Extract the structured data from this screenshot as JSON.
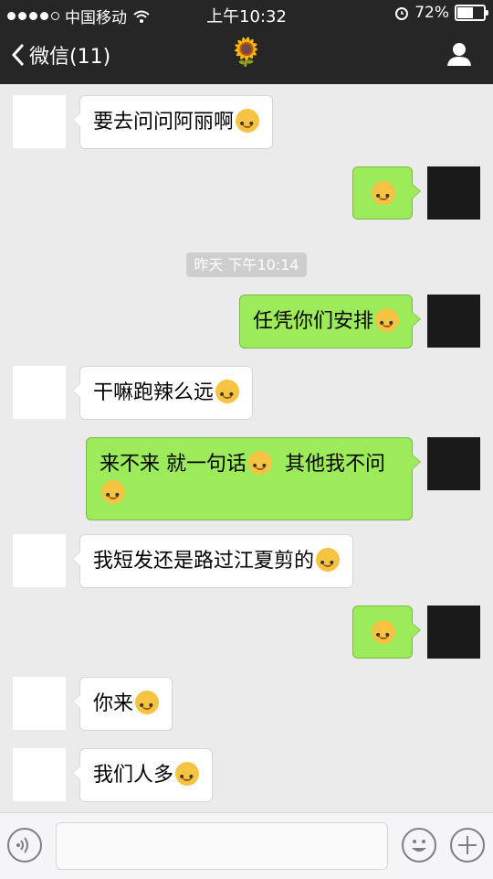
{
  "status_bar": {
    "carrier": "中国移动",
    "time": "上午10:32",
    "battery": "72%",
    "battery_level": 0.72
  },
  "nav": {
    "back_label": "微信(11)",
    "title": "🌻"
  },
  "timestamp": "昨天 下午10:14",
  "messages": [
    {
      "side": "left",
      "text": "要去问问阿丽啊",
      "emoji": true
    },
    {
      "side": "right",
      "text": "",
      "emoji": true
    },
    {
      "side": "right",
      "text": "任凭你们安排",
      "emoji": true
    },
    {
      "side": "left",
      "text": "干嘛跑辣么远",
      "emoji": true
    },
    {
      "side": "right",
      "text": "来不来 就一句话",
      "text_line2": "其他我不问",
      "emoji": true
    },
    {
      "side": "left",
      "text": "我短发还是路过江夏剪的",
      "emoji": true
    },
    {
      "side": "right",
      "text": "",
      "emoji": true
    },
    {
      "side": "left",
      "text": "你来",
      "emoji": true
    },
    {
      "side": "left",
      "text": "我们人多",
      "emoji": true
    }
  ],
  "icons": {
    "back": "chevron-left-icon",
    "profile": "person-icon",
    "voice": "voice-icon",
    "emoji_button": "smiley-icon",
    "plus": "plus-icon"
  }
}
